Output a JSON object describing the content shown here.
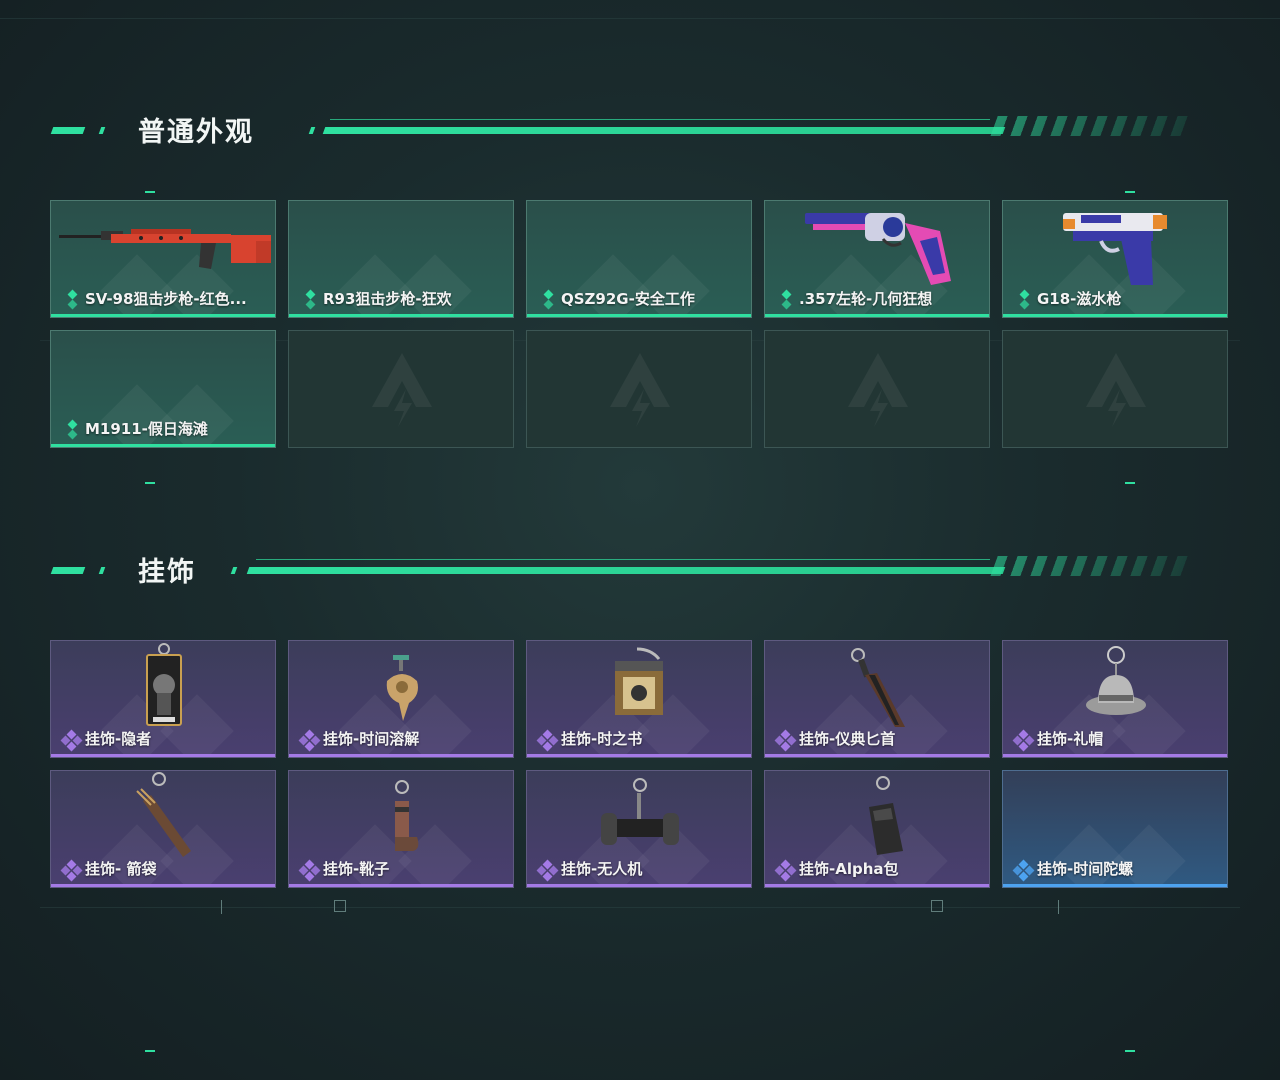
{
  "colors": {
    "accent_green": "#2fe0a0",
    "rarity_purple": "#a47ae6",
    "rarity_blue": "#4da3f0"
  },
  "sections": [
    {
      "title": "普通外观",
      "items": [
        {
          "name": "SV-98狙击步枪-红色...",
          "rarity": "green",
          "icon": "sniper-rifle-red"
        },
        {
          "name": "R93狙击步枪-狂欢",
          "rarity": "green",
          "icon": ""
        },
        {
          "name": "QSZ92G-安全工作",
          "rarity": "green",
          "icon": ""
        },
        {
          "name": ".357左轮-几何狂想",
          "rarity": "green",
          "icon": "revolver-pink-blue"
        },
        {
          "name": "G18-滋水枪",
          "rarity": "green",
          "icon": "pistol-water-gun"
        },
        {
          "name": "M1911-假日海滩",
          "rarity": "green",
          "icon": ""
        },
        {
          "name": "",
          "rarity": "empty",
          "icon": "empty-slot-logo"
        },
        {
          "name": "",
          "rarity": "empty",
          "icon": "empty-slot-logo"
        },
        {
          "name": "",
          "rarity": "empty",
          "icon": "empty-slot-logo"
        },
        {
          "name": "",
          "rarity": "empty",
          "icon": "empty-slot-logo"
        }
      ]
    },
    {
      "title": "挂饰",
      "items": [
        {
          "name": "挂饰-隐者",
          "rarity": "purple",
          "icon": "hermit-card-charm"
        },
        {
          "name": "挂饰-时间溶解",
          "rarity": "purple",
          "icon": "melting-clock-charm"
        },
        {
          "name": "挂饰-时之书",
          "rarity": "purple",
          "icon": "book-charm"
        },
        {
          "name": "挂饰-仪典匕首",
          "rarity": "purple",
          "icon": "dagger-charm"
        },
        {
          "name": "挂饰-礼帽",
          "rarity": "purple",
          "icon": "hat-charm"
        },
        {
          "name": "挂饰- 箭袋",
          "rarity": "purple",
          "icon": "quiver-charm"
        },
        {
          "name": "挂饰-靴子",
          "rarity": "purple",
          "icon": "boot-charm"
        },
        {
          "name": "挂饰-无人机",
          "rarity": "purple",
          "icon": "drone-charm"
        },
        {
          "name": "挂饰-Alpha包",
          "rarity": "purple",
          "icon": "bag-charm"
        },
        {
          "name": "挂饰-时间陀螺",
          "rarity": "blue",
          "icon": ""
        }
      ]
    }
  ]
}
